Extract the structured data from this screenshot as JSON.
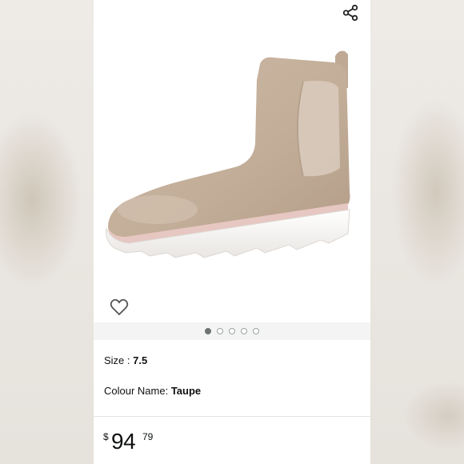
{
  "product": {
    "size_label": "Size : ",
    "size_value": "7.5",
    "colour_label": "Colour Name: ",
    "colour_value": "Taupe",
    "price_symbol": "$",
    "price_whole": "94",
    "price_fraction": "79",
    "image_description_icon": "chelsea-boot-image"
  },
  "carousel": {
    "total_images": 5,
    "active_index": 1
  },
  "icons": {
    "share": "share-icon",
    "wishlist": "heart-icon"
  },
  "colors": {
    "text": "#0f1111",
    "boot": "#c9b5a2",
    "sole": "#f5f3f1"
  }
}
